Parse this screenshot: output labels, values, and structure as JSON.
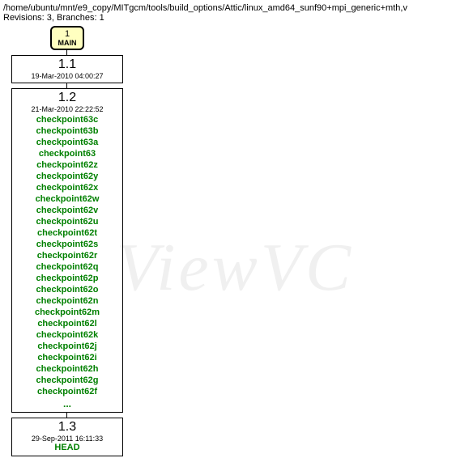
{
  "header": {
    "path": "/home/ubuntu/mnt/e9_copy/MITgcm/tools/build_options/Attic/linux_amd64_sunf90+mpi_generic+mth,v",
    "meta": "Revisions: 3, Branches: 1"
  },
  "main": {
    "num": "1",
    "label": "MAIN"
  },
  "revisions": [
    {
      "num": "1.1",
      "date": "19-Mar-2010 04:00:27",
      "tags": [],
      "head": null,
      "ellipsis": false
    },
    {
      "num": "1.2",
      "date": "21-Mar-2010 22:22:52",
      "tags": [
        "checkpoint63c",
        "checkpoint63b",
        "checkpoint63a",
        "checkpoint63",
        "checkpoint62z",
        "checkpoint62y",
        "checkpoint62x",
        "checkpoint62w",
        "checkpoint62v",
        "checkpoint62u",
        "checkpoint62t",
        "checkpoint62s",
        "checkpoint62r",
        "checkpoint62q",
        "checkpoint62p",
        "checkpoint62o",
        "checkpoint62n",
        "checkpoint62m",
        "checkpoint62l",
        "checkpoint62k",
        "checkpoint62j",
        "checkpoint62i",
        "checkpoint62h",
        "checkpoint62g",
        "checkpoint62f"
      ],
      "head": null,
      "ellipsis": true
    },
    {
      "num": "1.3",
      "date": "29-Sep-2011 16:11:33",
      "tags": [],
      "head": "HEAD",
      "ellipsis": false
    }
  ],
  "watermark": "ViewVC"
}
